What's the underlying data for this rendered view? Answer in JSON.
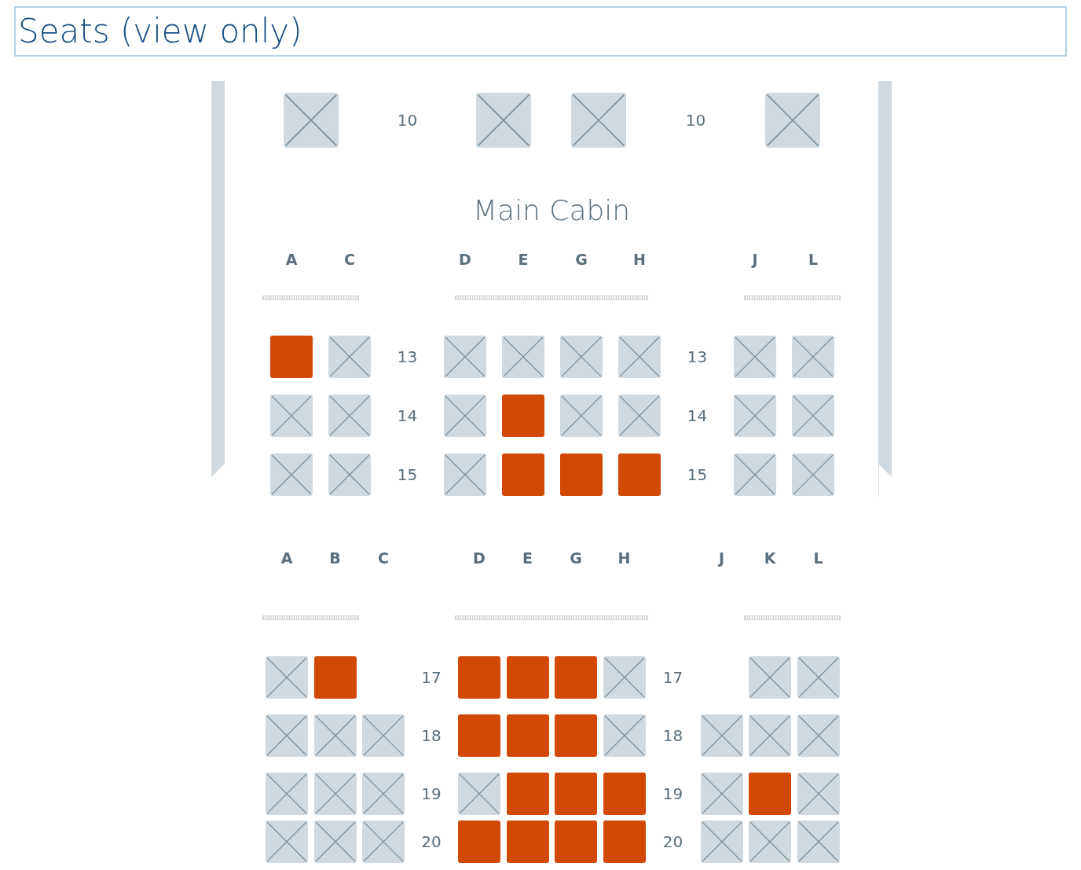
{
  "title": "Seats (view only)",
  "front_row": {
    "left": [
      {
        "kind": "seat",
        "available": false
      }
    ],
    "label_1": "10",
    "middle": [
      {
        "kind": "seat",
        "available": false
      },
      {
        "kind": "seat",
        "available": false
      }
    ],
    "label_2": "10",
    "right": [
      {
        "kind": "seat",
        "available": false
      }
    ]
  },
  "cabin_title": "Main Cabin",
  "sections": [
    {
      "columns": {
        "left": [
          "A",
          "C"
        ],
        "middle": [
          "D",
          "E",
          "G",
          "H"
        ],
        "right": [
          "J",
          "L"
        ]
      },
      "rows": [
        {
          "left": [
            {
              "kind": "seat",
              "available": true
            },
            {
              "kind": "seat",
              "available": false
            }
          ],
          "label_1": "13",
          "middle": [
            {
              "kind": "seat",
              "available": false
            },
            {
              "kind": "seat",
              "available": false
            },
            {
              "kind": "seat",
              "available": false
            },
            {
              "kind": "seat",
              "available": false
            }
          ],
          "label_2": "13",
          "right": [
            {
              "kind": "seat",
              "available": false
            },
            {
              "kind": "seat",
              "available": false
            }
          ]
        },
        {
          "left": [
            {
              "kind": "seat",
              "available": false
            },
            {
              "kind": "seat",
              "available": false
            }
          ],
          "label_1": "14",
          "middle": [
            {
              "kind": "seat",
              "available": false
            },
            {
              "kind": "seat",
              "available": true
            },
            {
              "kind": "seat",
              "available": false
            },
            {
              "kind": "seat",
              "available": false
            }
          ],
          "label_2": "14",
          "right": [
            {
              "kind": "seat",
              "available": false
            },
            {
              "kind": "seat",
              "available": false
            }
          ]
        },
        {
          "left": [
            {
              "kind": "seat",
              "available": false
            },
            {
              "kind": "seat",
              "available": false
            }
          ],
          "label_1": "15",
          "middle": [
            {
              "kind": "seat",
              "available": false
            },
            {
              "kind": "seat",
              "available": true
            },
            {
              "kind": "seat",
              "available": true
            },
            {
              "kind": "seat",
              "available": true
            }
          ],
          "label_2": "15",
          "right": [
            {
              "kind": "seat",
              "available": false
            },
            {
              "kind": "seat",
              "available": false
            }
          ]
        }
      ]
    },
    {
      "columns": {
        "left": [
          "A",
          "B",
          "C"
        ],
        "middle": [
          "D",
          "E",
          "G",
          "H"
        ],
        "right": [
          "J",
          "K",
          "L"
        ]
      },
      "rows": [
        {
          "left": [
            {
              "kind": "seat",
              "available": false
            },
            {
              "kind": "seat",
              "available": true
            },
            {
              "kind": "gap"
            }
          ],
          "label_1": "17",
          "middle": [
            {
              "kind": "seat",
              "available": true
            },
            {
              "kind": "seat",
              "available": true
            },
            {
              "kind": "seat",
              "available": true
            },
            {
              "kind": "seat",
              "available": false
            }
          ],
          "label_2": "17",
          "right": [
            {
              "kind": "gap"
            },
            {
              "kind": "seat",
              "available": false
            },
            {
              "kind": "seat",
              "available": false
            }
          ]
        },
        {
          "left": [
            {
              "kind": "seat",
              "available": false
            },
            {
              "kind": "seat",
              "available": false
            },
            {
              "kind": "seat",
              "available": false
            }
          ],
          "label_1": "18",
          "middle": [
            {
              "kind": "seat",
              "available": true
            },
            {
              "kind": "seat",
              "available": true
            },
            {
              "kind": "seat",
              "available": true
            },
            {
              "kind": "seat",
              "available": false
            }
          ],
          "label_2": "18",
          "right": [
            {
              "kind": "seat",
              "available": false
            },
            {
              "kind": "seat",
              "available": false
            },
            {
              "kind": "seat",
              "available": false
            }
          ]
        },
        {
          "left": [
            {
              "kind": "seat",
              "available": false
            },
            {
              "kind": "seat",
              "available": false
            },
            {
              "kind": "seat",
              "available": false
            }
          ],
          "label_1": "19",
          "middle": [
            {
              "kind": "seat",
              "available": false
            },
            {
              "kind": "seat",
              "available": true
            },
            {
              "kind": "seat",
              "available": true
            },
            {
              "kind": "seat",
              "available": true
            }
          ],
          "label_2": "19",
          "right": [
            {
              "kind": "seat",
              "available": false
            },
            {
              "kind": "seat",
              "available": true
            },
            {
              "kind": "seat",
              "available": false
            }
          ]
        },
        {
          "left": [
            {
              "kind": "seat",
              "available": false
            },
            {
              "kind": "seat",
              "available": false
            },
            {
              "kind": "seat",
              "available": false
            }
          ],
          "label_1": "20",
          "middle": [
            {
              "kind": "seat",
              "available": true
            },
            {
              "kind": "seat",
              "available": true
            },
            {
              "kind": "seat",
              "available": true
            },
            {
              "kind": "seat",
              "available": true
            }
          ],
          "label_2": "20",
          "right": [
            {
              "kind": "seat",
              "available": false
            },
            {
              "kind": "seat",
              "available": false
            },
            {
              "kind": "seat",
              "available": false
            }
          ]
        }
      ]
    }
  ]
}
